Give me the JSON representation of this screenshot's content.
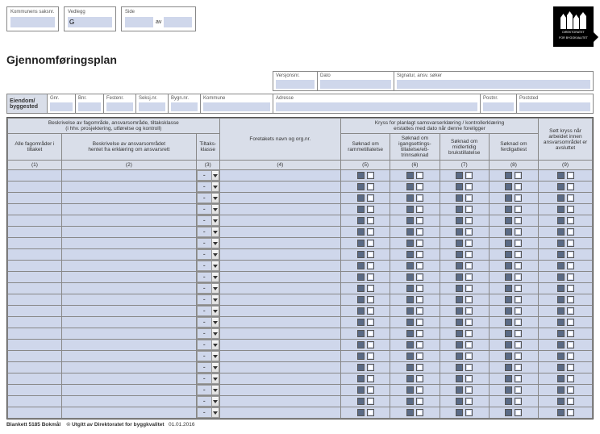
{
  "topBoxes": {
    "saksnr": {
      "label": "Kommunens saksnr.",
      "value": ""
    },
    "vedlegg": {
      "label": "Vedlegg",
      "value": "G"
    },
    "side": {
      "label": "Side",
      "sep": "av",
      "val1": "",
      "val2": ""
    }
  },
  "logo": {
    "line1": "DIREKTORATET",
    "line2": "FOR BYGGKVALITET"
  },
  "title": "Gjennomføringsplan",
  "hdr": {
    "versjon": "Versjonsnr.",
    "dato": "Dato",
    "signatur": "Signatur, ansv. søker",
    "eiendom": "Eiendom/ byggested",
    "gnr": "Gnr.",
    "bnr": "Bnr.",
    "festenr": "Festenr.",
    "seksjnr": "Seksj.nr.",
    "bygnnr": "Bygn.nr.",
    "kommune": "Kommune",
    "adresse": "Adresse",
    "postnr": "Postnr.",
    "poststed": "Poststed"
  },
  "cols": {
    "grpA": "Beskrivelse av fagområde, ansvarsområde, tiltaksklasse\n(i hhv. prosjektering, utførelse og kontroll)",
    "grpB": "Kryss for planlagt samsvarserklæring / kontrollerklæring\nerstattes med dato når denne foreligger",
    "c1": "Alle fagområder i tiltaket",
    "c2": "Beskrivelse av ansvarsområdet\nhentet fra erklæring om ansvarsrett",
    "c3": "Tiltaks-\nklasse",
    "c4": "Foretakets navn og org.nr.",
    "c5": "Søknad om rammetillatelse",
    "c6": "Søknad om igangsettings-tillatelse/ett-trinnsøknad",
    "c7": "Søknad om midlertidig brukstillatelse",
    "c8": "Søknad om ferdigattest",
    "c9": "Sett kryss når arbeidet innen ansvarsområdet er avsluttet",
    "n1": "(1)",
    "n2": "(2)",
    "n3": "(3)",
    "n4": "(4)",
    "n5": "(5)",
    "n6": "(6)",
    "n7": "(7)",
    "n8": "(8)",
    "n9": "(9)"
  },
  "rowCount": 22,
  "ddValue": "-",
  "footer": {
    "blank": "Blankett 5185 Bokmål",
    "pub": "© Utgitt av Direktoratet for byggkvalitet",
    "date": "01.01.2016"
  }
}
